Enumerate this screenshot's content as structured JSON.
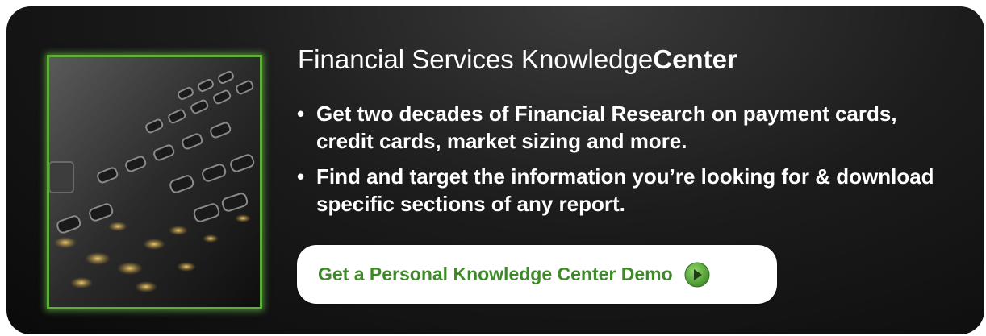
{
  "banner": {
    "title_regular": "Financial Services Knowledge",
    "title_bold": "Center",
    "bullets": [
      "Get two decades of Financial Research on payment cards, credit cards, market sizing and more.",
      "Find and target the information you’re looking for & download specific sections of any report."
    ],
    "bullet_symbol": "•",
    "cta_label": "Get a Personal Knowledge Center Demo",
    "cta_icon": "arrow-circle-right-icon",
    "image_subject": "credit-card-closeup",
    "colors": {
      "accent_green": "#3f8a28",
      "frame_green": "#5fae3c",
      "background": "#1c1c1c",
      "text": "#ffffff"
    }
  }
}
